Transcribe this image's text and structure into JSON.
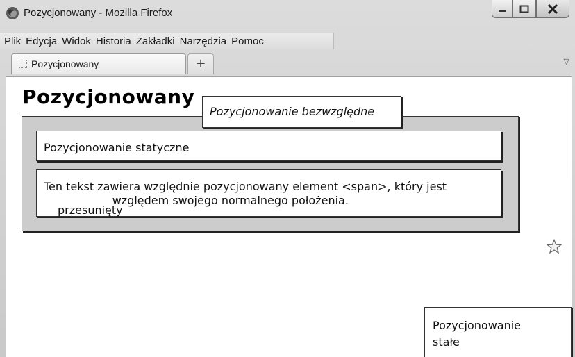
{
  "window": {
    "title": "Pozycjonowany - Mozilla Firefox",
    "icon": "firefox-icon",
    "controls": [
      "minimize-icon",
      "maximize-icon",
      "close-icon"
    ]
  },
  "menubar": {
    "items": [
      "Plik",
      "Edycja",
      "Widok",
      "Historia",
      "Zakładki",
      "Narzędzia",
      "Pomoc"
    ]
  },
  "tabs": {
    "active_label": "Pozycjonowany",
    "new_tab_label": "+",
    "list_tabs_icon": "chevron-down-icon"
  },
  "page": {
    "heading": "Pozycjonowany",
    "absolute_text": "Pozycjonowanie bezwzględne",
    "static_text": "Pozycjonowanie statyczne",
    "relative_text_before": "Ten tekst zawiera względnie pozycjonowany element <span>, który jest ",
    "relative_span": "przesunięty",
    "relative_text_after": " względem swojego normalnego położenia.",
    "fixed_text": "Pozycjonowanie stałe",
    "bookmark_icon": "star-icon"
  },
  "colors": {
    "container_bg": "#cccccc",
    "box_bg": "#ffffff",
    "border": "#333333"
  }
}
